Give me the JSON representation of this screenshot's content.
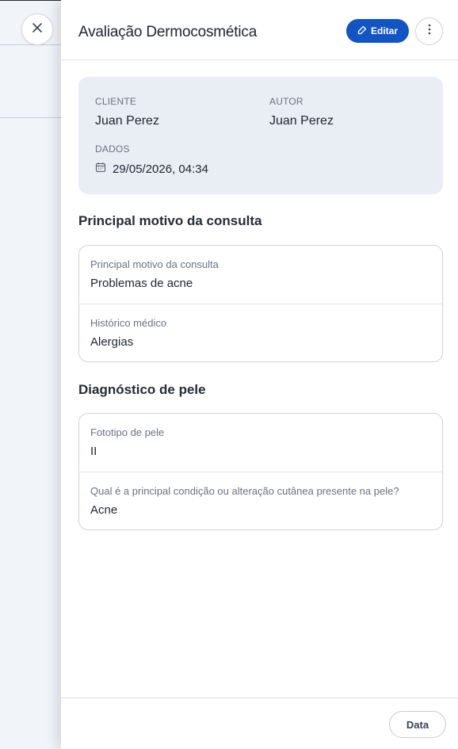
{
  "drawer": {
    "title": "Avaliação Dermocosmética",
    "edit_label": "Editar",
    "footer_button": "Data"
  },
  "summary": {
    "client_label": "CLIENTE",
    "client_value": "Juan Perez",
    "author_label": "AUTOR",
    "author_value": "Juan Perez",
    "data_label": "DADOS",
    "date_value": "29/05/2026, 04:34"
  },
  "sections": [
    {
      "title": "Principal motivo da consulta",
      "fields": [
        {
          "label": "Principal motivo da consulta",
          "value": "Problemas de acne"
        },
        {
          "label": "Histórico médico",
          "value": "Alergias"
        }
      ]
    },
    {
      "title": "Diagnóstico de pele",
      "fields": [
        {
          "label": "Fototipo de pele",
          "value": "II"
        },
        {
          "label": "Qual é a principal condição ou alteração cutânea presente na pele?",
          "value": "Acne"
        }
      ]
    }
  ],
  "colors": {
    "accent": "#1254c4",
    "summary_bg": "#e9eef5"
  },
  "icons": [
    "close-icon",
    "edit-icon",
    "more-vertical-icon",
    "calendar-icon"
  ]
}
